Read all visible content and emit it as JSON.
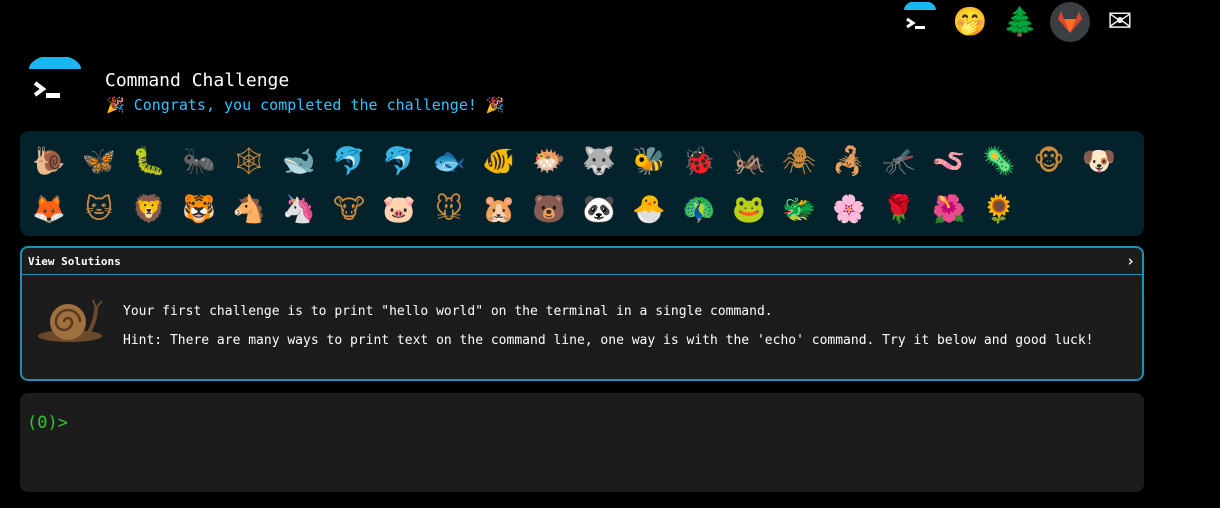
{
  "header": {
    "title": "Command Challenge",
    "congrats": "🎉 Congrats, you completed the challenge! 🎉"
  },
  "top_icons": [
    {
      "name": "command-challenge-icon"
    },
    {
      "name": "shushing-face-icon",
      "glyph": "🤭"
    },
    {
      "name": "pine-tree-icon",
      "glyph": "🌲"
    },
    {
      "name": "gitlab-icon"
    },
    {
      "name": "mail-icon",
      "glyph": "✉"
    }
  ],
  "emoji_rows": [
    [
      "🐌",
      "🦋",
      "🐛",
      "🐜",
      "🕸",
      "🐋",
      "🐬",
      "🐬",
      "🐟",
      "🐠",
      "🐡",
      "🐺",
      "🐝",
      "🐞",
      "🦗",
      "🕷",
      "🦂",
      "🦟",
      "🪱",
      "🦠",
      "🐵",
      "🐶"
    ],
    [
      "🦊",
      "🐱",
      "🦁",
      "🐯",
      "🐴",
      "🦄",
      "🐮",
      "🐷",
      "🐭",
      "🐹",
      "🐻",
      "🐼",
      "🐣",
      "🦚",
      "🐸",
      "🐲",
      "🌸",
      "🌹",
      "🌺",
      "🌻"
    ]
  ],
  "challenge": {
    "solutions_label": "View Solutions",
    "chevron": "›",
    "line1": "Your first challenge is to print \"hello world\" on the terminal in a single command.",
    "line2": "Hint: There are many ways to print text on the command line, one way is with the 'echo' command. Try it below and good luck!"
  },
  "terminal": {
    "prompt": "(0)>"
  }
}
